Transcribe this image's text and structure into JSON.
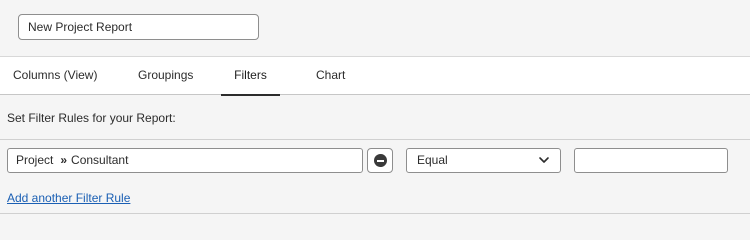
{
  "report": {
    "name_value": "New Project Report"
  },
  "tabs": [
    {
      "label": "Columns (View)",
      "active": false
    },
    {
      "label": "Groupings",
      "active": false
    },
    {
      "label": "Filters",
      "active": true
    },
    {
      "label": "Chart",
      "active": false
    }
  ],
  "filters": {
    "section_label": "Set Filter Rules for your Report:",
    "rule": {
      "field_parent": "Project",
      "separator": "»",
      "field_child": "Consultant",
      "operator": "Equal",
      "value": ""
    },
    "remove_icon": "minus-circle-icon",
    "add_rule_label": "Add another Filter Rule"
  },
  "colors": {
    "link": "#1a5fb4",
    "active_tab_underline": "#2c2c2c"
  }
}
